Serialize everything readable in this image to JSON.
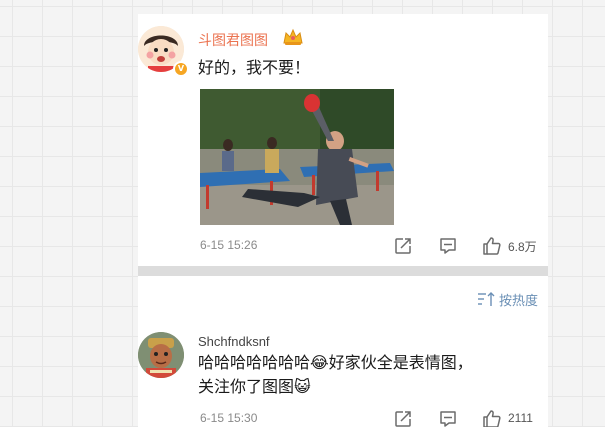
{
  "comments": [
    {
      "username": "斗图君图图",
      "verified_badge": "V",
      "verified_color": "#f6a623",
      "username_color": "#eb7350",
      "text_lines": [
        "好的，我不要！"
      ],
      "image": "ping-pong-player-gif",
      "timestamp": "6-15 15:26",
      "like_count": "6.8万",
      "icons": [
        "share-icon",
        "comment-icon",
        "like-icon"
      ]
    },
    {
      "username": "Shchfndksnf",
      "text_lines": [
        "哈哈哈哈哈哈哈😂好家伙全是表情图，",
        "关注你了图图😺"
      ],
      "timestamp": "6-15 15:30",
      "like_count": "2111",
      "icons": [
        "share-icon",
        "comment-icon",
        "like-icon"
      ]
    }
  ],
  "sort": {
    "label": "按热度",
    "icon": "sort-icon",
    "color": "#6a8fb5"
  }
}
